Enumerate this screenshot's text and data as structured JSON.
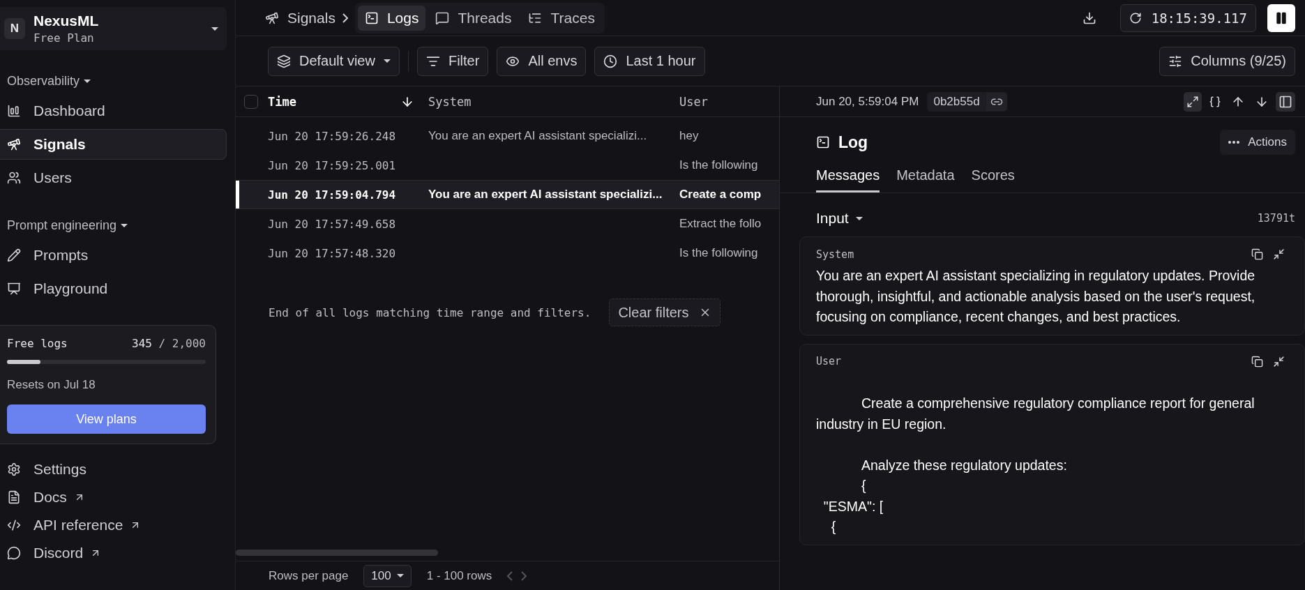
{
  "workspace": {
    "initial": "N",
    "name": "NexusML",
    "plan": "Free Plan"
  },
  "sidebar": {
    "sections": [
      {
        "title": "Observability",
        "items": [
          {
            "label": "Dashboard",
            "selected": false
          },
          {
            "label": "Signals",
            "selected": true
          },
          {
            "label": "Users",
            "selected": false
          }
        ]
      },
      {
        "title": "Prompt engineering",
        "items": [
          {
            "label": "Prompts",
            "selected": false
          },
          {
            "label": "Playground",
            "selected": false
          }
        ]
      }
    ],
    "footer_items": [
      {
        "label": "Settings",
        "external": false
      },
      {
        "label": "Docs",
        "external": true
      },
      {
        "label": "API reference",
        "external": true
      },
      {
        "label": "Discord",
        "external": true
      }
    ]
  },
  "usage_card": {
    "title": "Free logs",
    "used": "345",
    "limit": "/ 2,000",
    "level": 0.17,
    "reset": "Resets on Jul 18",
    "button": "View plans"
  },
  "breadcrumb": {
    "root": "Signals",
    "tabs": [
      {
        "label": "Logs",
        "selected": true
      },
      {
        "label": "Threads",
        "selected": false
      },
      {
        "label": "Traces",
        "selected": false
      }
    ]
  },
  "refresh_time": "18:15:39.117",
  "toolbar": {
    "view": "Default view",
    "buttons": [
      "Filter",
      "All envs",
      "Last 1 hour"
    ],
    "columns": "Columns (9/25)"
  },
  "table": {
    "all_selected": false,
    "columns": [
      "Time",
      "System",
      "User"
    ],
    "rows": [
      {
        "time": "Jun 20 17:59:26.248",
        "system": "You are an expert AI assistant specializi...",
        "user": "hey",
        "selected": false
      },
      {
        "time": "Jun 20 17:59:25.001",
        "system": "",
        "user": "Is the following",
        "selected": false
      },
      {
        "time": "Jun 20 17:59:04.794",
        "system": "You are an expert AI assistant specializi...",
        "user": "Create a comp",
        "selected": true
      },
      {
        "time": "Jun 20 17:57:49.658",
        "system": "",
        "user": "Extract the follo",
        "selected": false
      },
      {
        "time": "Jun 20 17:57:48.320",
        "system": "",
        "user": "Is the following",
        "selected": false
      }
    ],
    "end_message": "End of all logs matching time range and filters.",
    "clear_filters": "Clear filters"
  },
  "pagination": {
    "label": "Rows per page",
    "page_size": "100",
    "range": "1 - 100 rows"
  },
  "detail": {
    "timestamp": "Jun 20, 5:59:04 PM",
    "id": "0b2b55d",
    "title": "Log",
    "actions": "Actions",
    "tabs": [
      {
        "label": "Messages",
        "selected": true
      },
      {
        "label": "Metadata",
        "selected": false
      },
      {
        "label": "Scores",
        "selected": false
      }
    ],
    "section": "Input",
    "tokens": "13791t",
    "messages": [
      {
        "role": "System",
        "text": "You are an expert AI assistant specializing in regulatory updates. Provide thorough, insightful, and actionable analysis based on the user's request, focusing on compliance, recent changes, and best practices."
      },
      {
        "role": "User",
        "text": "\n            Create a comprehensive regulatory compliance report for general industry in EU region.\n\n            Analyze these regulatory updates:\n            {\n  \"ESMA\": [\n    {"
      }
    ]
  }
}
